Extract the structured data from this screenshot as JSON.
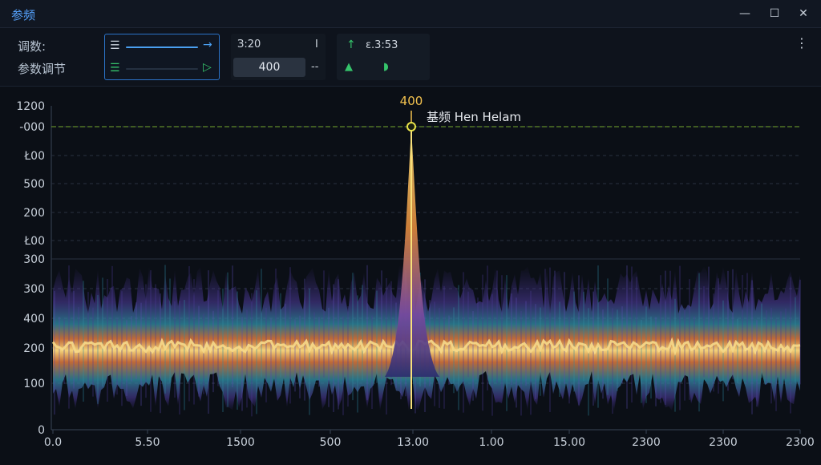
{
  "window": {
    "title": "参频",
    "min_icon": "minimize-icon",
    "max_icon": "maximize-icon",
    "close_icon": "close-icon"
  },
  "toolbar": {
    "label_line1": "调数:",
    "label_line2": "参数调节",
    "time_value": "З:20",
    "freq_input": "400",
    "dash": "--",
    "bar": "I",
    "status_time": "ε.3:53",
    "more_icon": "more-vertical-icon"
  },
  "chart_data": {
    "type": "line",
    "peak_label": "400",
    "peak_annotation": "基频 Hen Helam",
    "y_ticks": [
      "1200",
      "-000",
      "Ł00",
      "500",
      "200",
      "Ł00",
      "300",
      "300",
      "400",
      "200",
      "100",
      "0"
    ],
    "x_ticks": [
      "0.0",
      "5.50",
      "1500",
      "500",
      "13.00",
      "1.00",
      "15.00",
      "2300",
      "2300",
      "2300"
    ],
    "peak_x": "13.00",
    "colors": {
      "peak": "#f2c14e",
      "ref_line": "#5f8a2a",
      "grid": "#2a3240"
    }
  }
}
